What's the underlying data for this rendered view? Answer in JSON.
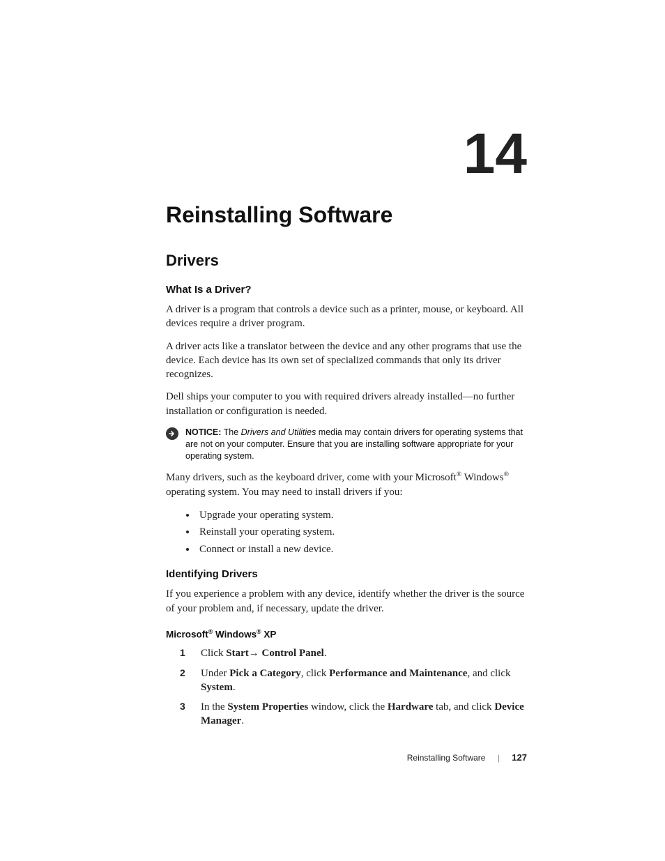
{
  "chapter": {
    "number": "14",
    "title": "Reinstalling Software"
  },
  "section": {
    "title": "Drivers"
  },
  "sub_what": {
    "title": "What Is a Driver?",
    "p1": "A driver is a program that controls a device such as a printer, mouse, or keyboard. All devices require a driver program.",
    "p2": "A driver acts like a translator between the device and any other programs that use the device. Each device has its own set of specialized commands that only its driver recognizes.",
    "p3": "Dell ships your computer to you with required drivers already installed—no further installation or configuration is needed."
  },
  "notice": {
    "label": "NOTICE:",
    "pre": " The ",
    "italic": "Drivers and Utilities",
    "post": " media may contain drivers for operating systems that are not on your computer. Ensure that you are installing software appropriate for your operating system."
  },
  "after_notice": {
    "pre": "Many drivers, such as the keyboard driver, come with your Microsoft",
    "mid": " Windows",
    "post": " operating system. You may need to install drivers if you:"
  },
  "bullets": [
    "Upgrade your operating system.",
    "Reinstall your operating system.",
    "Connect or install a new device."
  ],
  "sub_identify": {
    "title": "Identifying Drivers",
    "p1": "If you experience a problem with any device, identify whether the driver is the source of your problem and, if necessary, update the driver."
  },
  "os_heading": {
    "pre": "Microsoft",
    "mid": " Windows",
    "post": " XP"
  },
  "steps": {
    "s1a": "Click ",
    "s1b": "Start",
    "s1c": "→",
    "s1d": " Control Panel",
    "s1e": ".",
    "s2a": "Under ",
    "s2b": "Pick a Category",
    "s2c": ", click ",
    "s2d": "Performance and Maintenance",
    "s2e": ", and click ",
    "s2f": "System",
    "s2g": ".",
    "s3a": "In the ",
    "s3b": "System Properties",
    "s3c": " window, click the ",
    "s3d": "Hardware",
    "s3e": " tab, and click ",
    "s3f": "Device Manager",
    "s3g": "."
  },
  "footer": {
    "section": "Reinstalling Software",
    "page": "127"
  },
  "glyphs": {
    "reg": "®"
  }
}
